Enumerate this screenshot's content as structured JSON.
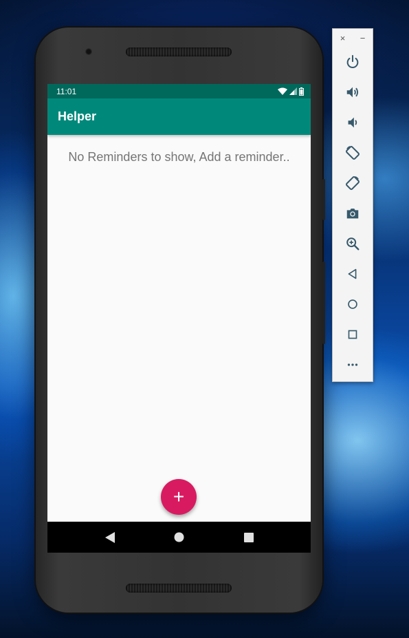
{
  "status_bar": {
    "time": "11:01"
  },
  "app_bar": {
    "title": "Helper"
  },
  "main": {
    "empty_message": "No Reminders to show, Add a reminder.."
  },
  "fab": {
    "label": "+",
    "color": "#d81b60"
  },
  "nav_bar": {
    "items": [
      "back",
      "home",
      "recents"
    ]
  },
  "emulator_toolbar": {
    "close_label": "×",
    "minimize_label": "−",
    "buttons": [
      "power-icon",
      "volume-up-icon",
      "volume-down-icon",
      "rotate-left-icon",
      "rotate-right-icon",
      "camera-icon",
      "zoom-icon",
      "back-icon",
      "home-icon",
      "overview-icon",
      "more-icon"
    ]
  },
  "colors": {
    "primary": "#00897b",
    "primary_dark": "#00695c",
    "accent": "#d81b60",
    "toolbar_icon": "#37596b"
  }
}
